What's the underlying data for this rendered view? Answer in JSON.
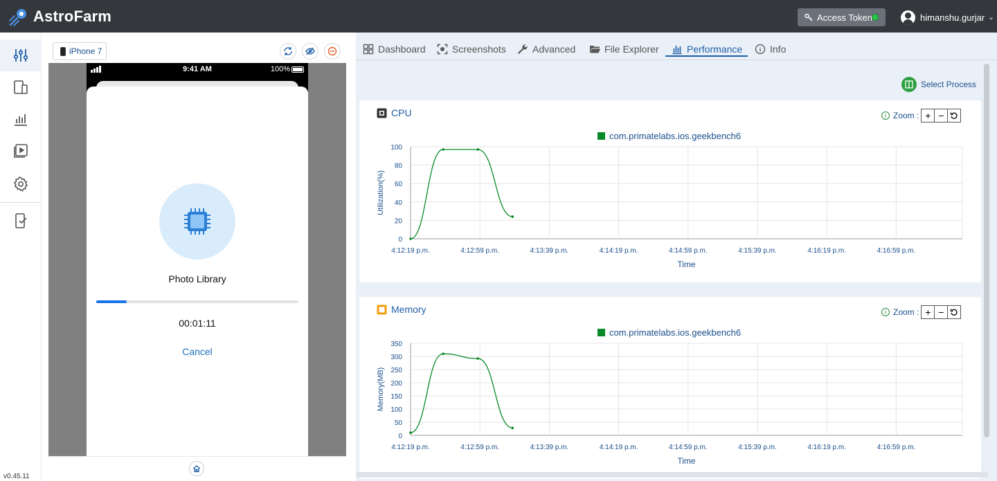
{
  "app": {
    "name": "AstroFarm",
    "version": "v0.45.11"
  },
  "header": {
    "access_token_label": "Access Token",
    "username": "himanshu.gurjar"
  },
  "device": {
    "name": "iPhone 7"
  },
  "phone": {
    "status_time": "9:41 AM",
    "battery": "100%",
    "sheet_title": "Photo Library",
    "progress": 0.15,
    "timer": "00:01:11",
    "cancel": "Cancel"
  },
  "tabs": [
    {
      "label": "Dashboard",
      "icon": "dashboard-icon"
    },
    {
      "label": "Screenshots",
      "icon": "screenshots-icon"
    },
    {
      "label": "Advanced",
      "icon": "wrench-icon"
    },
    {
      "label": "File Explorer",
      "icon": "folder-icon"
    },
    {
      "label": "Performance",
      "icon": "bar-chart-icon"
    },
    {
      "label": "Info",
      "icon": "info-icon"
    }
  ],
  "active_tab": "Performance",
  "select_process_label": "Select Process",
  "zoom_label": "Zoom :",
  "colors": {
    "series": "#0a8a2a",
    "accent": "#1f5fa8",
    "header": "#34383d"
  },
  "chart_data": [
    {
      "type": "line",
      "title": "CPU",
      "xlabel": "Time",
      "ylabel": "Utilization(%)",
      "x_ticks": [
        "4:12:19 p.m.",
        "4:12:59 p.m.",
        "4:13:39 p.m.",
        "4:14:19 p.m.",
        "4:14:59 p.m.",
        "4:15:39 p.m.",
        "4:16:19 p.m.",
        "4:16:59 p.m."
      ],
      "y_ticks": [
        0,
        20,
        40,
        60,
        80,
        100
      ],
      "ylim": [
        0,
        100
      ],
      "grid": true,
      "legend_position": "top-center",
      "series": [
        {
          "name": "com.primatelabs.ios.geekbench6",
          "x_index": [
            0,
            0.47,
            0.97,
            1.47
          ],
          "values": [
            0,
            97,
            97,
            24
          ]
        }
      ]
    },
    {
      "type": "line",
      "title": "Memory",
      "xlabel": "Time",
      "ylabel": "Memory(MB)",
      "x_ticks": [
        "4:12:19 p.m.",
        "4:12:59 p.m.",
        "4:13:39 p.m.",
        "4:14:19 p.m.",
        "4:14:59 p.m.",
        "4:15:39 p.m.",
        "4:16:19 p.m.",
        "4:16:59 p.m."
      ],
      "y_ticks": [
        0,
        50,
        100,
        150,
        200,
        250,
        300,
        350
      ],
      "ylim": [
        0,
        350
      ],
      "grid": true,
      "legend_position": "top-center",
      "series": [
        {
          "name": "com.primatelabs.ios.geekbench6",
          "x_index": [
            0,
            0.47,
            0.97,
            1.47
          ],
          "values": [
            10,
            310,
            292,
            28
          ]
        }
      ]
    }
  ]
}
